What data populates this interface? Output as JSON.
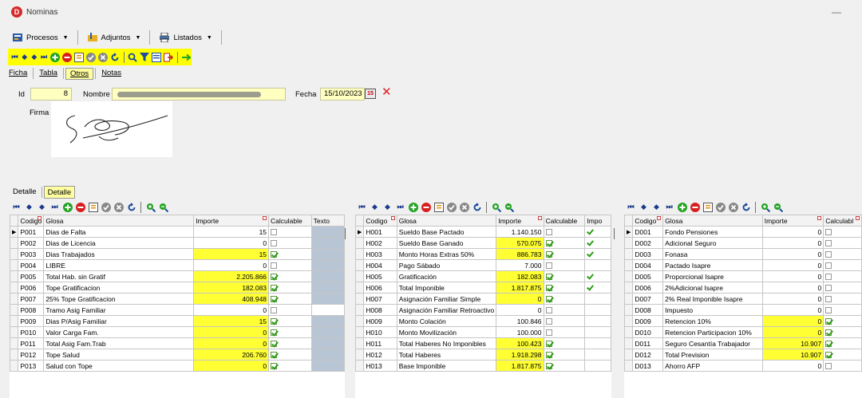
{
  "window": {
    "title": "Nominas",
    "minimize": "—"
  },
  "menu": {
    "procesos": "Procesos",
    "adjuntos": "Adjuntos",
    "listados": "Listados"
  },
  "form_tabs": {
    "ficha": "Ficha",
    "tabla": "Tabla",
    "otros": "Otros",
    "notas": "Notas"
  },
  "header": {
    "id_label": "Id",
    "id_value": "8",
    "nombre_label": "Nombre",
    "fecha_label": "Fecha",
    "fecha_value": "15/10/2023"
  },
  "firma_label": "Firma",
  "detail_tabs": {
    "tab1": "Detalle",
    "tab2": "Detalle"
  },
  "colors": {
    "accent_yellow": "#ffff00",
    "grid_yellow": "#ffff33",
    "check_green": "#2e9a1a",
    "close_red": "#e02020"
  },
  "table_p": {
    "headers": {
      "codigo": "Codigo",
      "glosa": "Glosa",
      "importe": "Importe",
      "calculable": "Calculable",
      "texto": "Texto"
    },
    "rows": [
      {
        "codigo": "P001",
        "glosa": "Dias de Falta",
        "importe": "15",
        "yellow": false,
        "check": false
      },
      {
        "codigo": "P002",
        "glosa": "Dias de Licencia",
        "importe": "0",
        "yellow": false,
        "check": false
      },
      {
        "codigo": "P003",
        "glosa": "Dias Trabajados",
        "importe": "15",
        "yellow": true,
        "check": true
      },
      {
        "codigo": "P004",
        "glosa": "LIBRE",
        "importe": "0",
        "yellow": false,
        "check": false
      },
      {
        "codigo": "P005",
        "glosa": "Total Hab. sin Gratif",
        "importe": "2.205.866",
        "yellow": true,
        "check": true
      },
      {
        "codigo": "P006",
        "glosa": "Tope Gratificacion",
        "importe": "182.083",
        "yellow": true,
        "check": true
      },
      {
        "codigo": "P007",
        "glosa": "25% Tope Gratificacion",
        "importe": "408.948",
        "yellow": true,
        "check": true
      },
      {
        "codigo": "P008",
        "glosa": "Tramo Asig Familiar",
        "importe": "0",
        "yellow": false,
        "check": false
      },
      {
        "codigo": "P009",
        "glosa": "Dias P/Asig Familiar",
        "importe": "15",
        "yellow": true,
        "check": true
      },
      {
        "codigo": "P010",
        "glosa": "Valor Carga Fam.",
        "importe": "0",
        "yellow": true,
        "check": true
      },
      {
        "codigo": "P011",
        "glosa": "Total Asig Fam.Trab",
        "importe": "0",
        "yellow": true,
        "check": true
      },
      {
        "codigo": "P012",
        "glosa": "Tope Salud",
        "importe": "206.760",
        "yellow": true,
        "check": true
      },
      {
        "codigo": "P013",
        "glosa": "Salud con Tope",
        "importe": "0",
        "yellow": true,
        "check": true
      }
    ]
  },
  "table_h": {
    "headers": {
      "codigo": "Codigo",
      "glosa": "Glosa",
      "importe": "Importe",
      "calculable": "Calculable",
      "impo": "Impo"
    },
    "rows": [
      {
        "codigo": "H001",
        "glosa": "Sueldo Base Pactado",
        "importe": "1.140.150",
        "yellow": false,
        "check": false,
        "impo": true
      },
      {
        "codigo": "H002",
        "glosa": "Sueldo Base Ganado",
        "importe": "570.075",
        "yellow": true,
        "check": true,
        "impo": true
      },
      {
        "codigo": "H003",
        "glosa": "Monto Horas Extras 50%",
        "importe": "886.783",
        "yellow": true,
        "check": true,
        "impo": true
      },
      {
        "codigo": "H004",
        "glosa": "Pago Sábado",
        "importe": "7.000",
        "yellow": false,
        "check": false,
        "impo": false
      },
      {
        "codigo": "H005",
        "glosa": "Gratificación",
        "importe": "182.083",
        "yellow": true,
        "check": true,
        "impo": true
      },
      {
        "codigo": "H006",
        "glosa": "Total Imponible",
        "importe": "1.817.875",
        "yellow": true,
        "check": true,
        "impo": true
      },
      {
        "codigo": "H007",
        "glosa": "Asignación Familiar Simple",
        "importe": "0",
        "yellow": true,
        "check": true,
        "impo": false
      },
      {
        "codigo": "H008",
        "glosa": "Asignación Familiar Retroactivo",
        "importe": "0",
        "yellow": false,
        "check": false,
        "impo": false
      },
      {
        "codigo": "H009",
        "glosa": "Monto Colación",
        "importe": "100.846",
        "yellow": false,
        "check": false,
        "impo": false
      },
      {
        "codigo": "H010",
        "glosa": "Monto Movilización",
        "importe": "100.000",
        "yellow": false,
        "check": false,
        "impo": false
      },
      {
        "codigo": "H011",
        "glosa": "Total Haberes No Imponibles",
        "importe": "100.423",
        "yellow": true,
        "check": true,
        "impo": false
      },
      {
        "codigo": "H012",
        "glosa": "Total Haberes",
        "importe": "1.918.298",
        "yellow": true,
        "check": true,
        "impo": false
      },
      {
        "codigo": "H013",
        "glosa": "Base Imponible",
        "importe": "1.817.875",
        "yellow": true,
        "check": true,
        "impo": false
      }
    ]
  },
  "table_d": {
    "headers": {
      "codigo": "Codigo",
      "glosa": "Glosa",
      "importe": "Importe",
      "calculable": "Calculabl"
    },
    "rows": [
      {
        "codigo": "D001",
        "glosa": "Fondo Pensiones",
        "importe": "0",
        "yellow": false,
        "check": false
      },
      {
        "codigo": "D002",
        "glosa": "Adicional Seguro",
        "importe": "0",
        "yellow": false,
        "check": false
      },
      {
        "codigo": "D003",
        "glosa": "Fonasa",
        "importe": "0",
        "yellow": false,
        "check": false
      },
      {
        "codigo": "D004",
        "glosa": "Pactado Isapre",
        "importe": "0",
        "yellow": false,
        "check": false
      },
      {
        "codigo": "D005",
        "glosa": "Proporcional Isapre",
        "importe": "0",
        "yellow": false,
        "check": false
      },
      {
        "codigo": "D006",
        "glosa": "2%Adicional Isapre",
        "importe": "0",
        "yellow": false,
        "check": false
      },
      {
        "codigo": "D007",
        "glosa": "2% Real Imponible Isapre",
        "importe": "0",
        "yellow": false,
        "check": false
      },
      {
        "codigo": "D008",
        "glosa": "Impuesto",
        "importe": "0",
        "yellow": false,
        "check": false
      },
      {
        "codigo": "D009",
        "glosa": "Retencion 10%",
        "importe": "0",
        "yellow": true,
        "check": true
      },
      {
        "codigo": "D010",
        "glosa": "Retencion Participacion 10%",
        "importe": "0",
        "yellow": true,
        "check": true
      },
      {
        "codigo": "D011",
        "glosa": "Seguro Cesantía Trabajador",
        "importe": "10.907",
        "yellow": true,
        "check": true
      },
      {
        "codigo": "D012",
        "glosa": "Total Prevision",
        "importe": "10.907",
        "yellow": true,
        "check": true
      },
      {
        "codigo": "D013",
        "glosa": "Ahorro AFP",
        "importe": "0",
        "yellow": false,
        "check": false
      }
    ]
  }
}
